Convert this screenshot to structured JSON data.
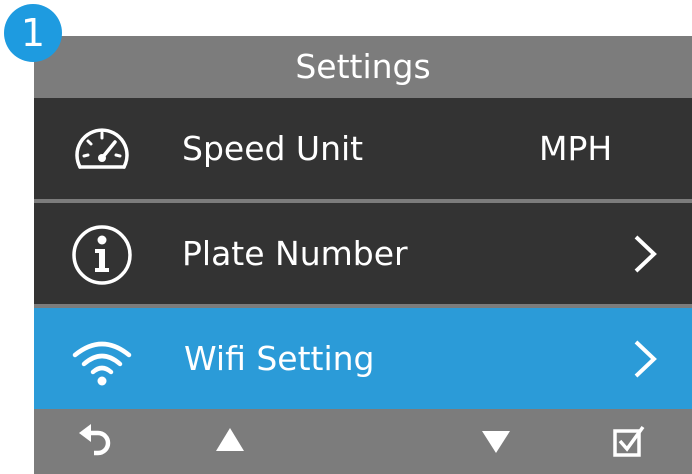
{
  "step_badge": "1",
  "title": "Settings",
  "menu": [
    {
      "label": "Speed Unit",
      "value": "MPH",
      "icon": "speedometer-icon",
      "selected": false
    },
    {
      "label": "Plate Number",
      "icon": "info-icon",
      "has_submenu": true,
      "selected": false
    },
    {
      "label": "Wifi Setting",
      "icon": "wifi-icon",
      "has_submenu": true,
      "selected": true
    }
  ],
  "buttons": [
    "back-icon",
    "up-arrow-icon",
    "down-arrow-icon",
    "confirm-icon"
  ],
  "colors": {
    "selected": "#2b9bd8",
    "row": "#333333",
    "bar": "#7c7c7c",
    "badge": "#1e9be0"
  }
}
